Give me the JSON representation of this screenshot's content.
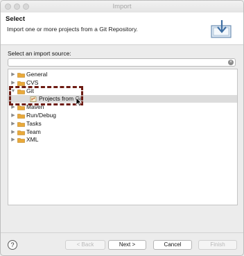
{
  "window": {
    "title": "Import"
  },
  "banner": {
    "title": "Select",
    "description": "Import one or more projects from a Git Repository."
  },
  "source": {
    "label": "Select an import source:",
    "filter_value": ""
  },
  "tree": {
    "items": [
      {
        "label": "General",
        "level": 0,
        "expanded": false,
        "icon": "folder-icon"
      },
      {
        "label": "CVS",
        "level": 0,
        "expanded": false,
        "icon": "folder-icon"
      },
      {
        "label": "Git",
        "level": 0,
        "expanded": true,
        "icon": "folder-open-icon"
      },
      {
        "label": "Projects from Git",
        "level": 1,
        "selected": true,
        "icon": "git-project-icon"
      },
      {
        "label": "Maven",
        "level": 0,
        "expanded": false,
        "icon": "folder-icon"
      },
      {
        "label": "Run/Debug",
        "level": 0,
        "expanded": false,
        "icon": "folder-icon"
      },
      {
        "label": "Tasks",
        "level": 0,
        "expanded": false,
        "icon": "folder-icon"
      },
      {
        "label": "Team",
        "level": 0,
        "expanded": false,
        "icon": "folder-icon"
      },
      {
        "label": "XML",
        "level": 0,
        "expanded": false,
        "icon": "folder-icon"
      }
    ]
  },
  "footer": {
    "help": "?",
    "back": "< Back",
    "next": "Next >",
    "cancel": "Cancel",
    "finish": "Finish"
  },
  "colors": {
    "highlight_border": "#6d1b12",
    "folder": "#e9a93a",
    "selected_row": "#dcdcdc"
  }
}
